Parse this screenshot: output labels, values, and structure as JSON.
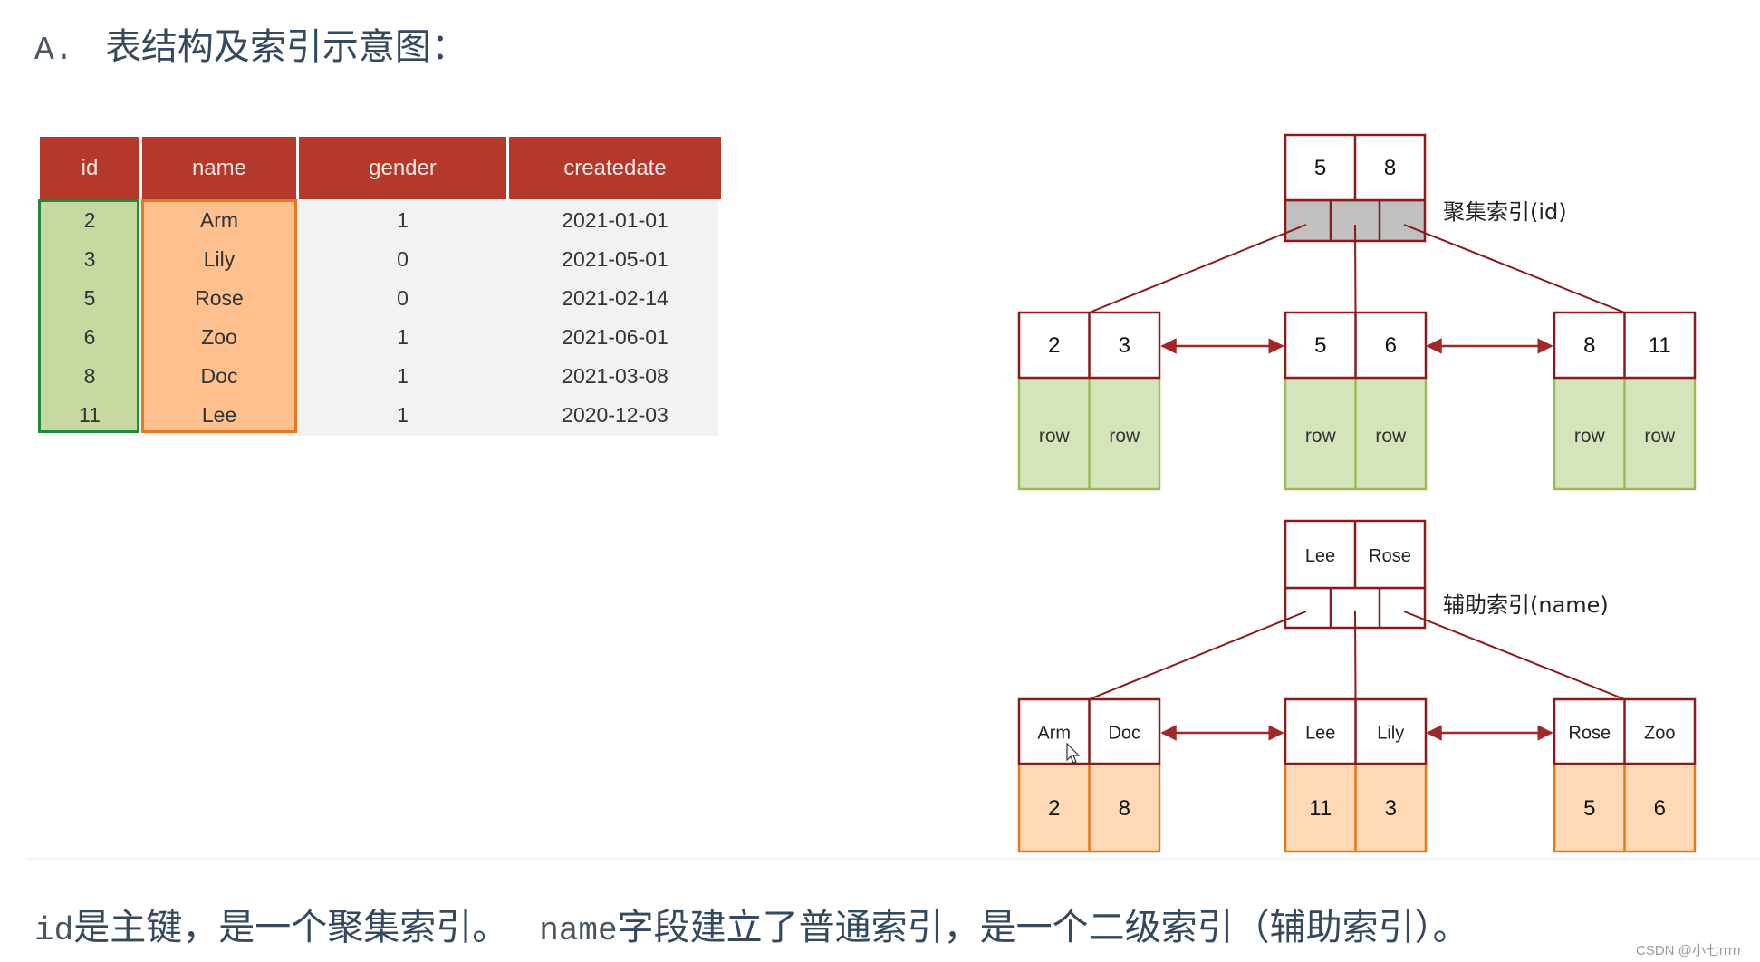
{
  "title": {
    "prefix": "A.",
    "text": "表结构及索引示意图："
  },
  "table": {
    "headers": [
      "id",
      "name",
      "gender",
      "createdate"
    ],
    "rows": [
      [
        "2",
        "Arm",
        "1",
        "2021-01-01"
      ],
      [
        "3",
        "Lily",
        "0",
        "2021-05-01"
      ],
      [
        "5",
        "Rose",
        "0",
        "2021-02-14"
      ],
      [
        "6",
        "Zoo",
        "1",
        "2021-06-01"
      ],
      [
        "8",
        "Doc",
        "1",
        "2021-03-08"
      ],
      [
        "11",
        "Lee",
        "1",
        "2020-12-03"
      ]
    ],
    "highlight": {
      "id_column_color": "#c5d9a0",
      "id_border": "#1e8a3c",
      "name_column_color": "#fdc08e",
      "name_border": "#e87722",
      "header_color": "#b5392a"
    }
  },
  "clustered_index": {
    "label": "聚集索引(id)",
    "root_keys": [
      "5",
      "8"
    ],
    "leaves": [
      {
        "keys": [
          "2",
          "3"
        ],
        "values": [
          "row",
          "row"
        ]
      },
      {
        "keys": [
          "5",
          "6"
        ],
        "values": [
          "row",
          "row"
        ]
      },
      {
        "keys": [
          "8",
          "11"
        ],
        "values": [
          "row",
          "row"
        ]
      }
    ]
  },
  "secondary_index": {
    "label": "辅助索引(name)",
    "root_keys": [
      "Lee",
      "Rose"
    ],
    "leaves": [
      {
        "keys": [
          "Arm",
          "Doc"
        ],
        "values": [
          "2",
          "8"
        ]
      },
      {
        "keys": [
          "Lee",
          "Lily"
        ],
        "values": [
          "11",
          "3"
        ]
      },
      {
        "keys": [
          "Rose",
          "Zoo"
        ],
        "values": [
          "5",
          "6"
        ]
      }
    ]
  },
  "colors": {
    "tree_line": "#8b1a1a",
    "root_pointer_fill": "#c0c0c0",
    "row_fill": "#d6e4bc",
    "row_border": "#9bbb59",
    "value_fill": "#fdd9b5",
    "value_border": "#e07b1a"
  },
  "footer": {
    "part1_mono": "id",
    "part1": "是主键，是一个聚集索引。",
    "part2_mono": "name",
    "part2": "字段建立了普通索引，是一个二级索引（辅助索引）。"
  },
  "watermark": "CSDN @小七rrrrr"
}
